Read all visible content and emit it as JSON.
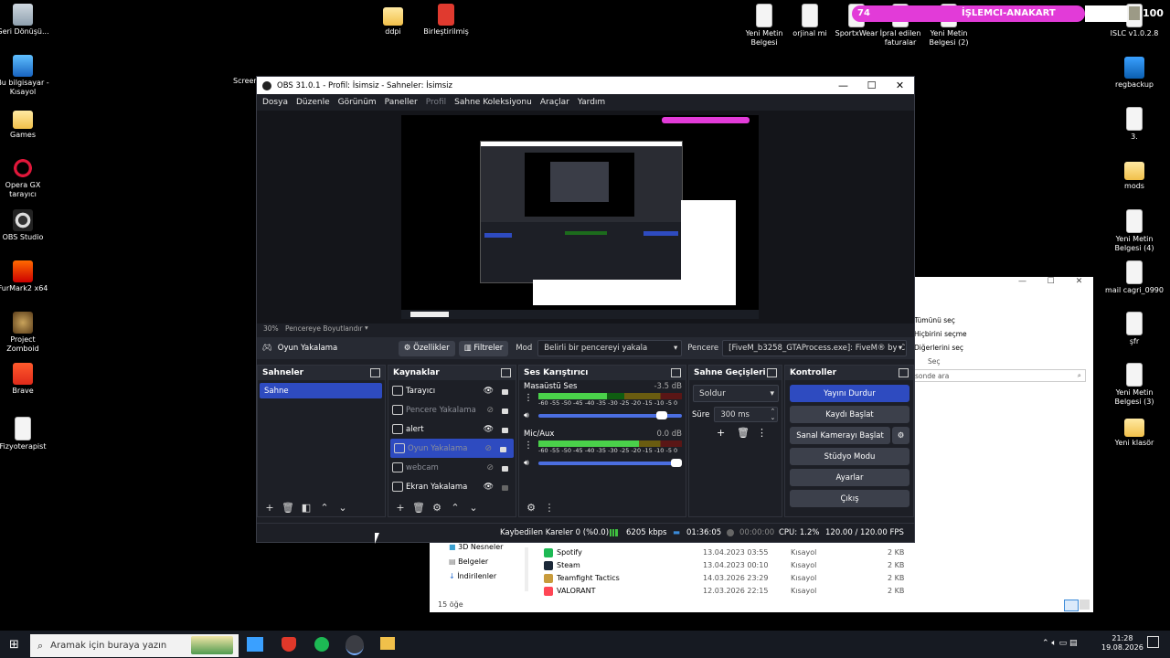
{
  "desktop_left": [
    {
      "label": "Geri Dönüşü...",
      "icon": "recycle-bin-icon",
      "cls": "g-bin"
    },
    {
      "label": "Bu bilgisayar - Kısayol",
      "icon": "computer-icon",
      "cls": "g-pc"
    },
    {
      "label": "Games",
      "icon": "folder-icon",
      "cls": "g-folder"
    },
    {
      "label": "Opera GX tarayıcı",
      "icon": "opera-gx-icon",
      "cls": "g-opera"
    },
    {
      "label": "OBS Studio",
      "icon": "obs-icon",
      "cls": "g-obs"
    },
    {
      "label": "FurMark2 x64",
      "icon": "furmark-icon",
      "cls": "g-fur"
    },
    {
      "label": "Project Zomboid",
      "icon": "project-zomboid-icon",
      "cls": "g-pz"
    },
    {
      "label": "Brave",
      "icon": "brave-icon",
      "cls": "g-brave"
    },
    {
      "label": "Fizyoterapist",
      "icon": "file-icon",
      "cls": "g-doc"
    }
  ],
  "desktop_top": [
    {
      "label": "ddpi",
      "icon": "folder-icon",
      "cls": "g-folder"
    },
    {
      "label": "Birleştirilmiş",
      "icon": "pdf-icon",
      "cls": "g-pdf"
    },
    {
      "label": "Yeni Metin Belgesi",
      "icon": "text-file-icon",
      "cls": "g-doc"
    },
    {
      "label": "orjinal mi",
      "icon": "text-file-icon",
      "cls": "g-doc"
    },
    {
      "label": "SportxWear",
      "icon": "text-file-icon",
      "cls": "g-doc"
    },
    {
      "label": "İpral edilen faturalar",
      "icon": "text-file-icon",
      "cls": "g-doc"
    },
    {
      "label": "Yeni Metin Belgesi (2)",
      "icon": "text-file-icon",
      "cls": "g-doc"
    },
    {
      "label": "ISLC v1.0.2.8",
      "icon": "islc-icon",
      "cls": "g-doc"
    }
  ],
  "desktop_right": [
    {
      "label": "regbackup",
      "icon": "regbackup-icon",
      "cls": "g-reg"
    },
    {
      "label": "3.",
      "icon": "text-file-icon",
      "cls": "g-doc"
    },
    {
      "label": "mods",
      "icon": "folder-icon",
      "cls": "g-folder"
    },
    {
      "label": "Yeni Metin Belgesi (4)",
      "icon": "text-file-icon",
      "cls": "g-doc"
    },
    {
      "label": "mail cagri_0990",
      "icon": "text-file-icon",
      "cls": "g-doc"
    },
    {
      "label": "şfr",
      "icon": "text-file-icon",
      "cls": "g-doc"
    },
    {
      "label": "Yeni Metin Belgesi (3)",
      "icon": "text-file-icon",
      "cls": "g-doc"
    },
    {
      "label": "Yeni klasör",
      "icon": "folder-icon",
      "cls": "g-folder"
    }
  ],
  "screen_label": "Screen",
  "cpu_widget": {
    "left_value": "74",
    "title": "İŞLEMCI-ANAKART",
    "right_value": "100",
    "bar_color": "#e23bd8"
  },
  "obs": {
    "title": "OBS 31.0.1 - Profil: İsimsiz - Sahneler: İsimsiz",
    "menu": [
      {
        "label": "Dosya",
        "dim": false
      },
      {
        "label": "Düzenle",
        "dim": false
      },
      {
        "label": "Görünüm",
        "dim": false
      },
      {
        "label": "Paneller",
        "dim": false
      },
      {
        "label": "Profil",
        "dim": true
      },
      {
        "label": "Sahne Koleksiyonu",
        "dim": false
      },
      {
        "label": "Araçlar",
        "dim": false
      },
      {
        "label": "Yardım",
        "dim": false
      }
    ],
    "zoom": "30%",
    "zoom_mode": "Pencereye Boyutlandır",
    "source_name": "Oyun Yakalama",
    "props_label": "Özellikler",
    "filters_label": "Filtreler",
    "mode_label": "Mod",
    "mode_value": "Belirli bir pencereyi yakala",
    "window_label": "Pencere",
    "window_value": "[FiveM_b3258_GTAProcess.exe]: FiveM® by C",
    "docks": {
      "scenes_title": "Sahneler",
      "sources_title": "Kaynaklar",
      "mixer_title": "Ses Karıştırıcı",
      "transitions_title": "Sahne Geçişleri",
      "controls_title": "Kontroller"
    },
    "scenes": [
      "Sahne"
    ],
    "sources": [
      {
        "name": "Tarayıcı",
        "visible": true,
        "locked": true,
        "active": false,
        "dim": false
      },
      {
        "name": "Pencere Yakalama",
        "visible": false,
        "locked": true,
        "active": false,
        "dim": true
      },
      {
        "name": "alert",
        "visible": true,
        "locked": true,
        "active": false,
        "dim": false
      },
      {
        "name": "Oyun Yakalama",
        "visible": false,
        "locked": true,
        "active": true,
        "dim": true
      },
      {
        "name": "webcam",
        "visible": false,
        "locked": true,
        "active": false,
        "dim": true
      },
      {
        "name": "Ekran Yakalama",
        "visible": true,
        "locked": false,
        "active": false,
        "dim": false
      }
    ],
    "mixer": [
      {
        "name": "Masaüstü Ses",
        "db": "-3.5 dB",
        "level": 0.48,
        "volume": 0.9
      },
      {
        "name": "Mic/Aux",
        "db": "0.0 dB",
        "level": 0.7,
        "volume": 1.0
      }
    ],
    "ticks": "-60 -55 -50 -45 -40 -35 -30 -25 -20 -15 -10 -5 0",
    "transition_value": "Soldur",
    "duration_label": "Süre",
    "duration_value": "300 ms",
    "controls": [
      "Yayını Durdur",
      "Kaydı Başlat",
      "Sanal Kamerayı Başlat",
      "Stüdyo Modu",
      "Ayarlar",
      "Çıkış"
    ],
    "status": {
      "dropped": "Kaybedilen Kareler 0 (%0.0)",
      "bitrate": "6205 kbps",
      "stream_time": "01:36:05",
      "rec_time": "00:00:00",
      "cpu": "CPU: 1.2%",
      "fps": "120.00 / 120.00 FPS"
    }
  },
  "explorer": {
    "menu": [
      "Tümünü seç",
      "Hiçbirini seçme",
      "Diğerlerini seç"
    ],
    "group": "Seç",
    "search_placeholder": "sonde ara",
    "nav": [
      "3D Nesneler",
      "Belgeler",
      "İndirilenler"
    ],
    "rows": [
      {
        "name": "Spotify",
        "date": "13.04.2023 03:55",
        "type": "Kısayol",
        "size": "2 KB"
      },
      {
        "name": "Steam",
        "date": "13.04.2023 00:10",
        "type": "Kısayol",
        "size": "2 KB"
      },
      {
        "name": "Teamfight Tactics",
        "date": "14.03.2026 23:29",
        "type": "Kısayol",
        "size": "2 KB"
      },
      {
        "name": "VALORANT",
        "date": "12.03.2026 22:15",
        "type": "Kısayol",
        "size": "2 KB"
      }
    ],
    "count": "15 öğe"
  },
  "taskbar": {
    "search_placeholder": "Aramak için buraya yazın",
    "time": "21:28",
    "date": "19.08.2026"
  }
}
